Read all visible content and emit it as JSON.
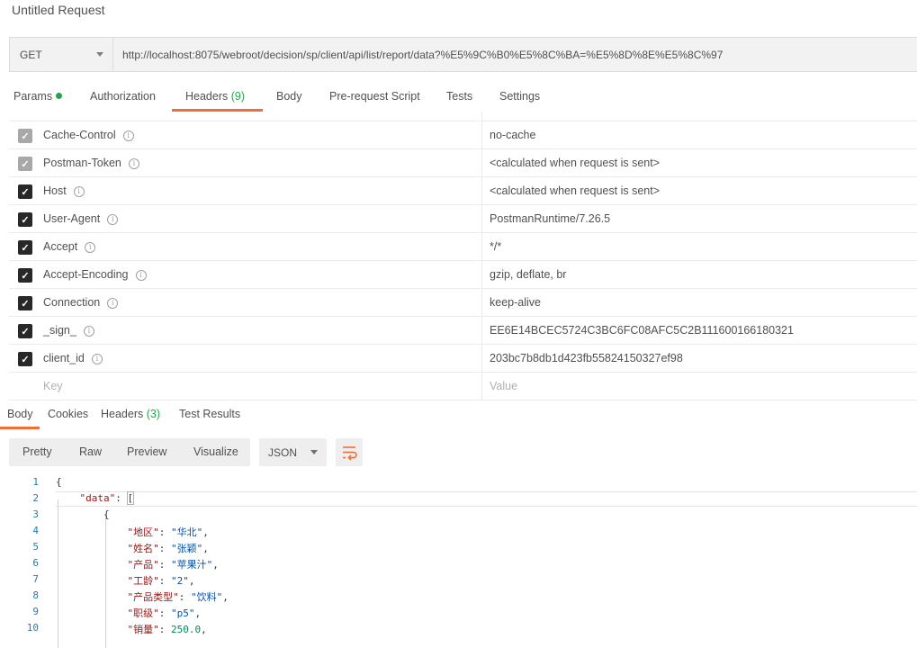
{
  "title": "Untitled Request",
  "request": {
    "method": "GET",
    "url": "http://localhost:8075/webroot/decision/sp/client/api/list/report/data?%E5%9C%B0%E5%8C%BA=%E5%8D%8E%E5%8C%97"
  },
  "request_tabs": {
    "params": "Params",
    "authorization": "Authorization",
    "headers": "Headers",
    "headers_count": "(9)",
    "body": "Body",
    "prerequest": "Pre-request Script",
    "tests": "Tests",
    "settings": "Settings"
  },
  "headers": [
    {
      "key": "Cache-Control",
      "value": "no-cache",
      "checked": true,
      "disabled": true
    },
    {
      "key": "Postman-Token",
      "value": "<calculated when request is sent>",
      "checked": true,
      "disabled": true
    },
    {
      "key": "Host",
      "value": "<calculated when request is sent>",
      "checked": true,
      "disabled": false
    },
    {
      "key": "User-Agent",
      "value": "PostmanRuntime/7.26.5",
      "checked": true,
      "disabled": false
    },
    {
      "key": "Accept",
      "value": "*/*",
      "checked": true,
      "disabled": false
    },
    {
      "key": "Accept-Encoding",
      "value": "gzip, deflate, br",
      "checked": true,
      "disabled": false
    },
    {
      "key": "Connection",
      "value": "keep-alive",
      "checked": true,
      "disabled": false
    },
    {
      "key": "_sign_",
      "value": "EE6E14BCEC5724C3BC6FC08AFC5C2B111600166180321",
      "checked": true,
      "disabled": false
    },
    {
      "key": "client_id",
      "value": "203bc7b8db1d423fb55824150327ef98",
      "checked": true,
      "disabled": false
    }
  ],
  "new_header": {
    "key_placeholder": "Key",
    "value_placeholder": "Value"
  },
  "response_tabs": {
    "body": "Body",
    "cookies": "Cookies",
    "headers": "Headers",
    "headers_count": "(3)",
    "test_results": "Test Results"
  },
  "view_modes": {
    "pretty": "Pretty",
    "raw": "Raw",
    "preview": "Preview",
    "visualize": "Visualize"
  },
  "format": "JSON",
  "code_lines": [
    {
      "n": "1",
      "parts": [
        [
          "p",
          "{"
        ]
      ]
    },
    {
      "n": "2",
      "parts": [
        [
          "p",
          "    "
        ],
        [
          "k",
          "\"data\""
        ],
        [
          "p",
          ": "
        ],
        [
          "b",
          "["
        ]
      ]
    },
    {
      "n": "3",
      "parts": [
        [
          "p",
          "        {"
        ]
      ]
    },
    {
      "n": "4",
      "parts": [
        [
          "p",
          "            "
        ],
        [
          "k",
          "\"地区\""
        ],
        [
          "p",
          ": "
        ],
        [
          "s",
          "\"华北\""
        ],
        [
          "p",
          ","
        ]
      ]
    },
    {
      "n": "5",
      "parts": [
        [
          "p",
          "            "
        ],
        [
          "k",
          "\"姓名\""
        ],
        [
          "p",
          ": "
        ],
        [
          "s",
          "\"张颖\""
        ],
        [
          "p",
          ","
        ]
      ]
    },
    {
      "n": "6",
      "parts": [
        [
          "p",
          "            "
        ],
        [
          "k",
          "\"产品\""
        ],
        [
          "p",
          ": "
        ],
        [
          "s",
          "\"苹果汁\""
        ],
        [
          "p",
          ","
        ]
      ]
    },
    {
      "n": "7",
      "parts": [
        [
          "p",
          "            "
        ],
        [
          "k",
          "\"工龄\""
        ],
        [
          "p",
          ": "
        ],
        [
          "s",
          "\"2\""
        ],
        [
          "p",
          ","
        ]
      ]
    },
    {
      "n": "8",
      "parts": [
        [
          "p",
          "            "
        ],
        [
          "k",
          "\"产品类型\""
        ],
        [
          "p",
          ": "
        ],
        [
          "s",
          "\"饮料\""
        ],
        [
          "p",
          ","
        ]
      ]
    },
    {
      "n": "9",
      "parts": [
        [
          "p",
          "            "
        ],
        [
          "k",
          "\"职级\""
        ],
        [
          "p",
          ": "
        ],
        [
          "s",
          "\"p5\""
        ],
        [
          "p",
          ","
        ]
      ]
    },
    {
      "n": "10",
      "parts": [
        [
          "p",
          "            "
        ],
        [
          "k",
          "\"销量\""
        ],
        [
          "p",
          ": "
        ],
        [
          "n",
          "250.0"
        ],
        [
          "p",
          ","
        ]
      ]
    }
  ],
  "colors": {
    "accent": "#f26b3a",
    "count": "#26a34a"
  }
}
